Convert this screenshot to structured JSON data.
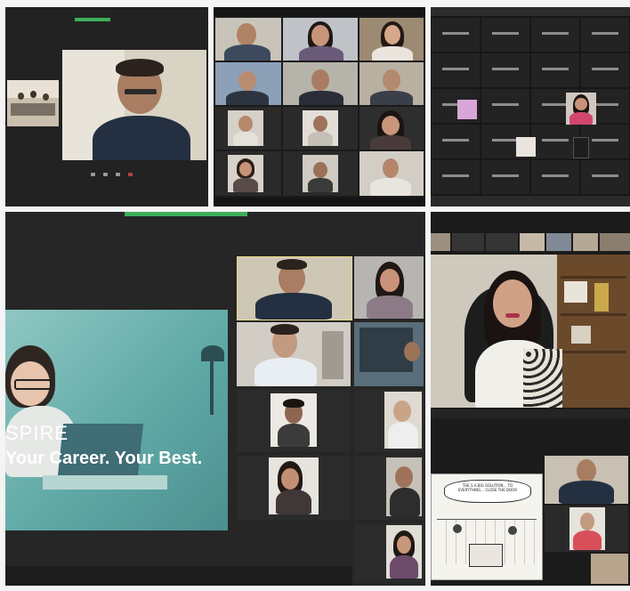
{
  "collage": {
    "title": "",
    "panels": [
      {
        "id": "top-left",
        "description": "speaker view"
      },
      {
        "id": "top-middle",
        "description": "gallery view"
      },
      {
        "id": "top-right",
        "description": "names grid"
      },
      {
        "id": "bottom-left",
        "description": "shared screen + gallery"
      },
      {
        "id": "bottom-right",
        "description": "speaker + gallery"
      }
    ]
  },
  "shared_slide": {
    "brand": "SPIRE",
    "tagline": "Your Career. Your Best."
  },
  "comic": {
    "caption": "THE S.A.BIG SOLUTION... TO EVERYTHING... CLOSE THE DOOR"
  },
  "colors": {
    "meeting_bg": "#1f1f1f",
    "tile_bg": "#2a2a2a",
    "active_speaker_bar": "#3fae5a",
    "slide_teal": "#5fa9a6"
  },
  "icons": [
    "mic-icon",
    "video-icon",
    "share-icon",
    "end-call-icon"
  ]
}
